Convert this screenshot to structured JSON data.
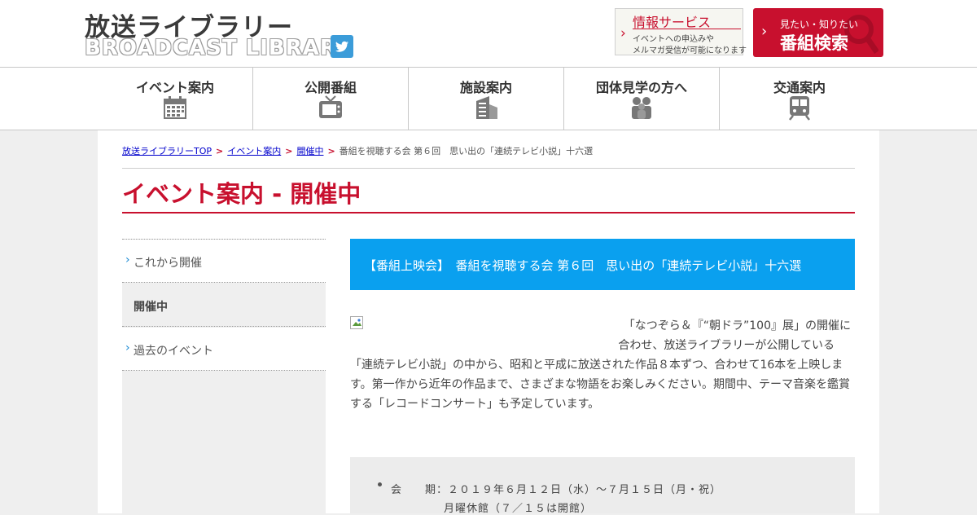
{
  "header": {
    "logo_ja": "放送ライブラリー",
    "logo_en": "BROADCAST LIBRARY",
    "twitter_icon": "twitter-icon",
    "info_service": {
      "title": "情報サービス",
      "line1": "イベントへの申込みや",
      "line2": "メルマガ受信が可能になります"
    },
    "program_search": {
      "sub": "見たい・知りたい",
      "main": "番組検索"
    },
    "colors": {
      "accent_red": "#c8102e",
      "twitter_blue": "#3b9cd9"
    }
  },
  "nav": {
    "items": [
      {
        "label": "イベント案内",
        "icon": "calendar-icon"
      },
      {
        "label": "公開番組",
        "icon": "tv-icon"
      },
      {
        "label": "施設案内",
        "icon": "building-icon"
      },
      {
        "label": "団体見学の方へ",
        "icon": "group-icon"
      },
      {
        "label": "交通案内",
        "icon": "train-icon"
      }
    ]
  },
  "breadcrumb": {
    "items": [
      "放送ライブラリーTOP",
      "イベント案内",
      "開催中"
    ],
    "current": "番組を視聴する会 第６回　思い出の「連続テレビ小説」十六選",
    "separator": ">"
  },
  "page_title": "イベント案内 - 開催中",
  "side_menu": {
    "items": [
      {
        "label": "これから開催",
        "active": false
      },
      {
        "label": "開催中",
        "active": true
      },
      {
        "label": "過去のイベント",
        "active": false
      }
    ]
  },
  "event": {
    "title": "【番組上映会】　番組を視聴する会 第６回　思い出の「連続テレビ小説」十六選",
    "banner_color": "#0aa0ef",
    "description_lines": [
      "「なつぞら＆『“朝ドラ”100』展」の開催に",
      "合わせ、放送ライブラリーが公開している",
      "「連続テレビ小説」の中から、昭和と平成に放送された作品８本ずつ、合わせて16本を上映しま",
      "す。第一作から近年の作品まで、さまざまな物語をお楽しみください。期間中、テーマ音楽を鑑賞",
      "する「レコードコンサート」も予定しています。"
    ],
    "info": {
      "period": "会　　期：２０１９年６月１２日（水）～７月１５日（月・祝）",
      "closed": "月曜休館（７／１５は開館）"
    }
  }
}
